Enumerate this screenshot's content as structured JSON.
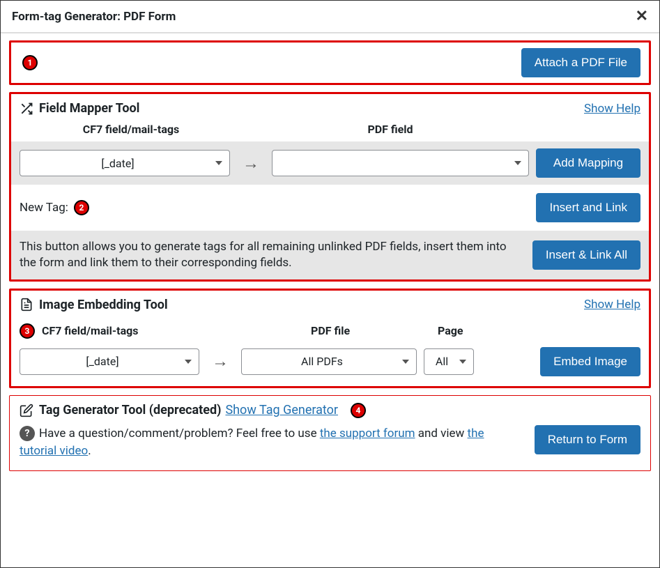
{
  "header": {
    "title": "Form-tag Generator: PDF Form"
  },
  "attach": {
    "button": "Attach a PDF File"
  },
  "mapper": {
    "title": "Field Mapper Tool",
    "show_help": "Show Help",
    "col_cf7": "CF7 field/mail-tags",
    "col_pdf": "PDF field",
    "cf7_value": "[_date]",
    "pdf_value": "",
    "add_mapping": "Add Mapping",
    "new_tag_label": "New Tag:",
    "insert_link": "Insert and Link",
    "desc": "This button allows you to generate tags for all remaining unlinked PDF fields, insert them into the form and link them to their corresponding fields.",
    "insert_link_all": "Insert & Link All"
  },
  "embed": {
    "title": "Image Embedding Tool",
    "show_help": "Show Help",
    "col_cf7": "CF7 field/mail-tags",
    "col_pdf_file": "PDF file",
    "col_page": "Page",
    "cf7_value": "[_date]",
    "pdf_file_value": "All PDFs",
    "page_value": "All",
    "embed_btn": "Embed Image"
  },
  "gen": {
    "title": "Tag Generator Tool (deprecated)",
    "link": "Show Tag Generator",
    "help_text1": "Have a question/comment/problem? Feel free to use ",
    "help_link1": "the support forum",
    "help_text2": " and view ",
    "help_link2": "the tutorial video",
    "help_text3": ".",
    "return_btn": "Return to Form"
  },
  "badges": {
    "b1": "1",
    "b2": "2",
    "b3": "3",
    "b4": "4"
  }
}
